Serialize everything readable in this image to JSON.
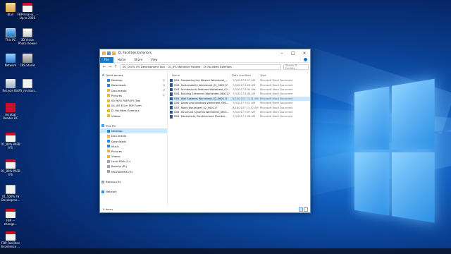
{
  "desktop": {
    "icons_left": [
      {
        "label": "Blair",
        "icon": "user-folder-icon",
        "style": "g-user"
      },
      {
        "label": "This PC",
        "icon": "this-pc-icon",
        "style": "g-pc"
      },
      {
        "label": "Network",
        "icon": "network-icon",
        "style": "g-net"
      },
      {
        "label": "Recycle Bin",
        "icon": "recycle-bin-icon",
        "style": "g-bin"
      },
      {
        "label": "Acrobat Reader DC",
        "icon": "acrobat-icon",
        "style": "g-acro"
      },
      {
        "label": "01_80% PAFB IFS",
        "icon": "pdf-file-icon",
        "style": "g-pdf"
      },
      {
        "label": "01_80% PAFB IFS",
        "icon": "pdf-file-icon",
        "style": "g-pdf"
      },
      {
        "label": "01_100% FS Developme...",
        "icon": "document-icon",
        "style": "g-doc"
      },
      {
        "label": "FBP — change...",
        "icon": "pdf-file-icon",
        "style": "g-pdf"
      },
      {
        "label": "FBP-Facilities Excellence ...",
        "icon": "pdf-file-icon",
        "style": "g-pdf"
      }
    ],
    "icons_right": [
      {
        "label": "FBP-Final-w... - Up to 2016",
        "icon": "pdf-file-icon",
        "style": "g-pdf"
      },
      {
        "label": "3D Vision Photo Viewer",
        "icon": "photo-viewer-icon",
        "style": "g-photo"
      },
      {
        "label": "CBS Studio",
        "icon": "app-icon",
        "style": "g-cbs"
      },
      {
        "label": "IFS_revision...",
        "icon": "document-icon",
        "style": "g-doc"
      }
    ]
  },
  "window": {
    "title": "D. Facilities Exteriors",
    "ribbon_tabs": [
      "File",
      "Home",
      "Share",
      "View"
    ],
    "address": [
      "00_100% IFS Development Tool",
      "01_IFS Narrative Folders",
      "D. Facilities Exteriors"
    ],
    "search_placeholder": "Search D. Facilitie...",
    "columns": {
      "name": "Name",
      "date": "Date modified",
      "type": "Type"
    },
    "nav": [
      {
        "label": "Quick access",
        "icon": "star",
        "cls": "ni-star",
        "pin": false,
        "sel": false,
        "indent": 2
      },
      {
        "label": "Desktop",
        "icon": "desktop",
        "cls": "ni-blue",
        "pin": true,
        "sel": false,
        "indent": 10
      },
      {
        "label": "Downloads",
        "icon": "downloads",
        "cls": "ni-blue",
        "pin": true,
        "sel": false,
        "indent": 10
      },
      {
        "label": "Documents",
        "icon": "documents",
        "cls": "ni-folder",
        "pin": true,
        "sel": false,
        "indent": 10
      },
      {
        "label": "Pictures",
        "icon": "pictures",
        "cls": "ni-folder",
        "pin": true,
        "sel": false,
        "indent": 10
      },
      {
        "label": "00_90% PAFB IFS Tool",
        "icon": "folder",
        "cls": "ni-folder",
        "pin": false,
        "sel": false,
        "indent": 10
      },
      {
        "label": "04_IFS Fill-in PDF Form",
        "icon": "folder",
        "cls": "ni-folder",
        "pin": false,
        "sel": false,
        "indent": 10
      },
      {
        "label": "D. Facilities Exteriors",
        "icon": "folder",
        "cls": "ni-folder",
        "pin": false,
        "sel": false,
        "indent": 10
      },
      {
        "label": "Videos",
        "icon": "videos",
        "cls": "ni-folder",
        "pin": false,
        "sel": false,
        "indent": 10
      },
      {
        "label": "",
        "icon": "",
        "cls": "",
        "pin": false,
        "sel": false,
        "indent": 0
      },
      {
        "label": "This PC",
        "icon": "pc",
        "cls": "ni-pc",
        "pin": false,
        "sel": false,
        "indent": 2
      },
      {
        "label": "Desktop",
        "icon": "desktop",
        "cls": "ni-blue",
        "pin": false,
        "sel": true,
        "indent": 10
      },
      {
        "label": "Documents",
        "icon": "documents",
        "cls": "ni-folder",
        "pin": false,
        "sel": false,
        "indent": 10
      },
      {
        "label": "Downloads",
        "icon": "downloads",
        "cls": "ni-blue",
        "pin": false,
        "sel": false,
        "indent": 10
      },
      {
        "label": "Music",
        "icon": "music",
        "cls": "ni-blue",
        "pin": false,
        "sel": false,
        "indent": 10
      },
      {
        "label": "Pictures",
        "icon": "pictures",
        "cls": "ni-folder",
        "pin": false,
        "sel": false,
        "indent": 10
      },
      {
        "label": "Videos",
        "icon": "videos",
        "cls": "ni-folder",
        "pin": false,
        "sel": false,
        "indent": 10
      },
      {
        "label": "Local Disk (C:)",
        "icon": "drive",
        "cls": "ni-drive",
        "pin": false,
        "sel": false,
        "indent": 10
      },
      {
        "label": "Backup (D:)",
        "icon": "drive",
        "cls": "ni-drive",
        "pin": false,
        "sel": false,
        "indent": 10
      },
      {
        "label": "MEDIAMERS (E:)",
        "icon": "drive",
        "cls": "ni-drive",
        "pin": false,
        "sel": false,
        "indent": 10
      },
      {
        "label": "",
        "icon": "",
        "cls": "",
        "pin": false,
        "sel": false,
        "indent": 0
      },
      {
        "label": "Backup (D:)",
        "icon": "drive",
        "cls": "ni-drive",
        "pin": false,
        "sel": false,
        "indent": 2
      },
      {
        "label": "",
        "icon": "",
        "cls": "",
        "pin": false,
        "sel": false,
        "indent": 0
      },
      {
        "label": "Network",
        "icon": "network",
        "cls": "ni-net",
        "pin": false,
        "sel": false,
        "indent": 2
      }
    ],
    "files": [
      {
        "name": "D01. Supporting the Mission Worksheet_...",
        "date": "7/3/2017 8:27 AM",
        "type": "Microsoft Word Document",
        "sel": false
      },
      {
        "name": "D02. Sustainability Worksheet_02_060117",
        "date": "7/3/2017 8:28 AM",
        "type": "Microsoft Word Document",
        "sel": false
      },
      {
        "name": "D03. Architectural Features Worksheet_02...",
        "date": "7/3/2017 8:44 AM",
        "type": "Microsoft Word Document",
        "sel": false
      },
      {
        "name": "D04. Building Entrances Worksheet_060217",
        "date": "7/3/2017 8:46 AM",
        "type": "Microsoft Word Document",
        "sel": false
      },
      {
        "name": "D05. Wall Systems Worksheet_02_060117",
        "date": "8/16/2017 11:21 AM",
        "type": "Microsoft Word Document",
        "sel": true
      },
      {
        "name": "D06. Doors and Windows Worksheet_060...",
        "date": "7/3/2017 9:01 AM",
        "type": "Microsoft Word Document",
        "sel": false
      },
      {
        "name": "D07. Roofs Worksheet_02_060117",
        "date": "8/16/2017 11:37 AM",
        "type": "Microsoft Word Document",
        "sel": false
      },
      {
        "name": "D08. Structural Systems Worksheet_0601...",
        "date": "7/3/2017 9:07 AM",
        "type": "Microsoft Word Document",
        "sel": false
      },
      {
        "name": "D09. Mechanical, Electrical and Plumbin...",
        "date": "7/3/2017 9:08 AM",
        "type": "Microsoft Word Document",
        "sel": false
      }
    ],
    "status": "9 items"
  }
}
